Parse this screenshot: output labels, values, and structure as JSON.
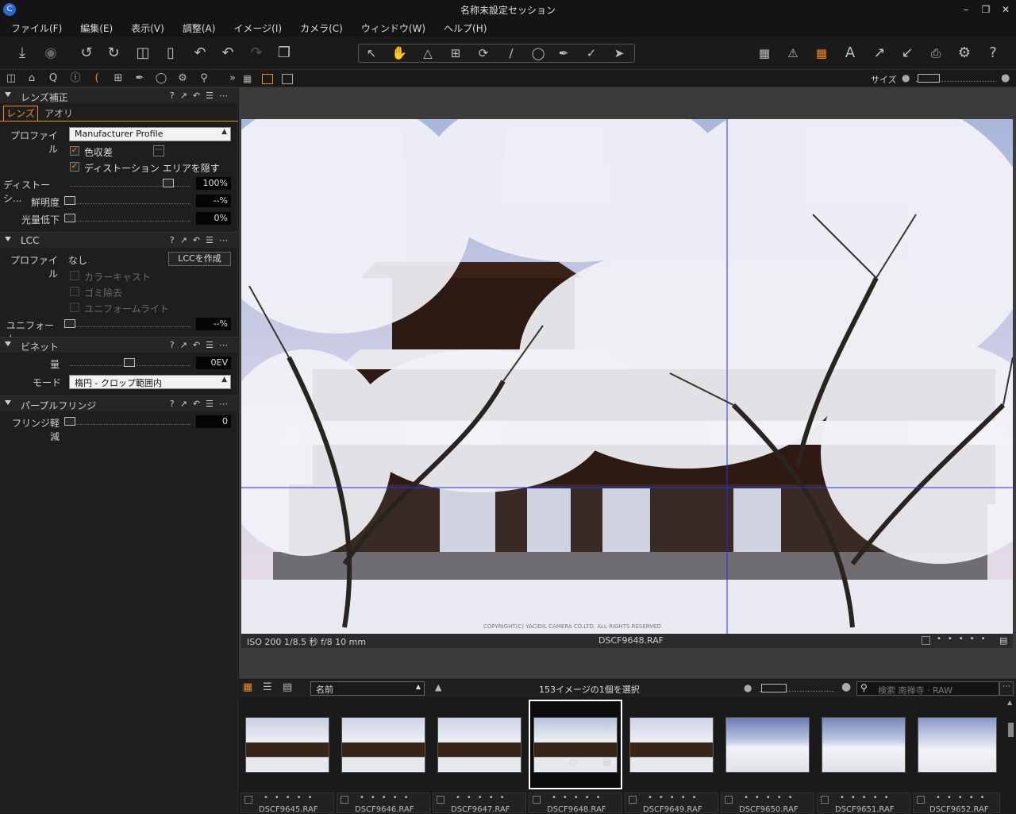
{
  "window": {
    "title": "名称未設定セッション"
  },
  "menu": [
    "ファイル(F)",
    "編集(E)",
    "表示(V)",
    "調整(A)",
    "イメージ(I)",
    "カメラ(C)",
    "ウィンドウ(W)",
    "ヘルプ(H)"
  ],
  "viewer_header": {
    "size_label": "サイズ"
  },
  "lens_section": {
    "title": "レンズ補正",
    "tabs": [
      "レンズ",
      "アオリ"
    ],
    "profile_label": "プロファイル",
    "profile_value": "Manufacturer Profile",
    "chromatic_label": "色収差",
    "hide_distortion_label": "ディストーション エリアを隠す",
    "distortion_label": "ディストーシ...",
    "distortion_value": "100%",
    "sharpness_label": "鮮明度",
    "sharpness_value": "--%",
    "falloff_label": "光量低下",
    "falloff_value": "0%"
  },
  "lcc_section": {
    "title": "LCC",
    "profile_label": "プロファイル",
    "profile_value": "なし",
    "create_button": "LCCを作成",
    "color_cast": "カラーキャスト",
    "dust_removal": "ゴミ除去",
    "uniform_light": "ユニフォームライト",
    "uniform_label": "ユニフォーム...",
    "uniform_value": "--%"
  },
  "vignette_section": {
    "title": "ビネット",
    "amount_label": "量",
    "amount_value": "0EV",
    "mode_label": "モード",
    "mode_value": "楕円 - クロップ範囲内"
  },
  "fringe_section": {
    "title": "パープルフリンジ",
    "reduction_label": "フリンジ軽減",
    "reduction_value": "0"
  },
  "viewer": {
    "exif": "ISO 200  1/8.5 秒  f/8  10 mm",
    "filename": "DSCF9648.RAF",
    "watermark": "COPYRIGHT(C) YACIDIL CAMERA CO.LTD. ALL RIGHTS RESERVED"
  },
  "browser": {
    "sort_value": "名前",
    "selection_status": "153イメージの1個を選択",
    "search_placeholder": "検索 南禅寺 · RAW",
    "thumbnails": [
      {
        "name": "DSCF9645.RAF"
      },
      {
        "name": "DSCF9646.RAF"
      },
      {
        "name": "DSCF9647.RAF"
      },
      {
        "name": "DSCF9648.RAF"
      },
      {
        "name": "DSCF9649.RAF"
      },
      {
        "name": "DSCF9650.RAF"
      },
      {
        "name": "DSCF9651.RAF"
      },
      {
        "name": "DSCF9652.RAF"
      }
    ]
  },
  "colors": {
    "accent": "#f08a24",
    "guide": "#2a2aff"
  }
}
